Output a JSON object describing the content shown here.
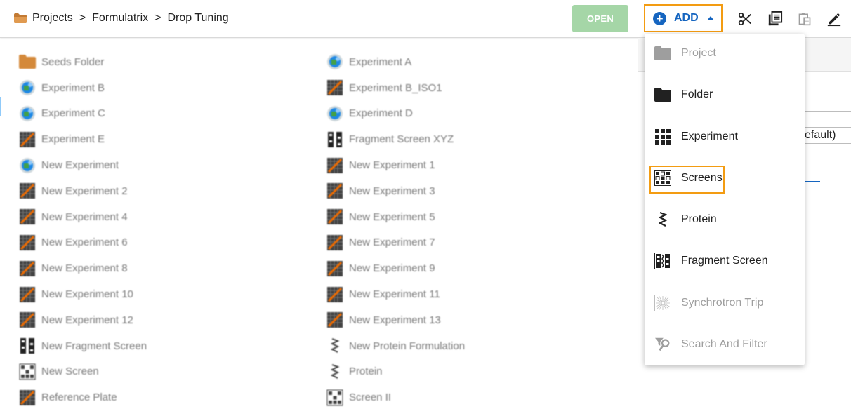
{
  "breadcrumb": [
    "Projects",
    "Formulatrix",
    "Drop Tuning"
  ],
  "breadcrumb_separator": ">",
  "toolbar": {
    "open_label": "OPEN",
    "add_label": "ADD",
    "tools": [
      "scissors-icon",
      "copy-icon",
      "paste-icon",
      "edit-icon"
    ]
  },
  "right_panel": {
    "field_text": "efault)"
  },
  "list_left": [
    {
      "label": "Seeds Folder",
      "icon": "folder"
    },
    {
      "label": "Experiment B",
      "icon": "globe"
    },
    {
      "label": "Experiment C",
      "icon": "globe"
    },
    {
      "label": "Experiment E",
      "icon": "plate"
    },
    {
      "label": "New Experiment",
      "icon": "globe"
    },
    {
      "label": "New Experiment 2",
      "icon": "plate"
    },
    {
      "label": "New Experiment 4",
      "icon": "plate"
    },
    {
      "label": "New Experiment 6",
      "icon": "plate"
    },
    {
      "label": "New Experiment 8",
      "icon": "plate"
    },
    {
      "label": "New Experiment 10",
      "icon": "plate"
    },
    {
      "label": "New Experiment 12",
      "icon": "plate"
    },
    {
      "label": "New Fragment Screen",
      "icon": "fragment"
    },
    {
      "label": "New Screen",
      "icon": "screen"
    },
    {
      "label": "Reference Plate",
      "icon": "plate"
    }
  ],
  "list_right": [
    {
      "label": "Experiment A",
      "icon": "globe"
    },
    {
      "label": "Experiment B_ISO1",
      "icon": "plate"
    },
    {
      "label": "Experiment D",
      "icon": "globe"
    },
    {
      "label": "Fragment Screen XYZ",
      "icon": "fragment"
    },
    {
      "label": "New Experiment 1",
      "icon": "plate"
    },
    {
      "label": "New Experiment 3",
      "icon": "plate"
    },
    {
      "label": "New Experiment 5",
      "icon": "plate"
    },
    {
      "label": "New Experiment 7",
      "icon": "plate"
    },
    {
      "label": "New Experiment 9",
      "icon": "plate"
    },
    {
      "label": "New Experiment 11",
      "icon": "plate"
    },
    {
      "label": "New Experiment 13",
      "icon": "plate"
    },
    {
      "label": "New Protein Formulation",
      "icon": "protein"
    },
    {
      "label": "Protein",
      "icon": "protein"
    },
    {
      "label": "Screen II",
      "icon": "screen"
    }
  ],
  "add_menu": [
    {
      "label": "Project",
      "icon": "project-folder-icon",
      "disabled": true
    },
    {
      "label": "Folder",
      "icon": "folder-icon",
      "disabled": false
    },
    {
      "label": "Experiment",
      "icon": "experiment-grid-icon",
      "disabled": false
    },
    {
      "label": "Screens",
      "icon": "screens-icon",
      "disabled": false,
      "highlighted": true
    },
    {
      "label": "Protein",
      "icon": "protein-icon",
      "disabled": false
    },
    {
      "label": "Fragment Screen",
      "icon": "fragment-screen-icon",
      "disabled": false
    },
    {
      "label": "Synchrotron Trip",
      "icon": "synchrotron-icon",
      "disabled": true
    },
    {
      "label": "Search And Filter",
      "icon": "search-filter-icon",
      "disabled": true
    }
  ],
  "colors": {
    "accent_blue": "#1565c0",
    "highlight_orange": "#f39c12",
    "open_button": "#a5d6a7",
    "folder": "#d4893a"
  }
}
